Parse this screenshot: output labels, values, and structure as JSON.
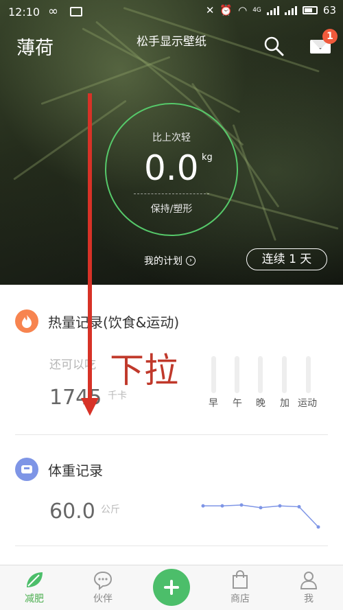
{
  "status_bar": {
    "time": "12:10",
    "signal_label": "4G",
    "battery": "63"
  },
  "header": {
    "app_name": "薄荷",
    "wallpaper_hint": "松手显示壁纸",
    "unread_count": "1"
  },
  "weight_card": {
    "compare_label": "比上次轻",
    "value": "0.0",
    "unit": "kg",
    "goal": "保持/塑形"
  },
  "plan": {
    "label": "我的计划"
  },
  "streak": {
    "label": "连续 1 天"
  },
  "calorie_section": {
    "title": "热量记录(饮食&运动)",
    "remaining_label": "还可以吃",
    "remaining_value": "1745",
    "unit": "千卡",
    "meals": [
      "早",
      "午",
      "晚",
      "加",
      "运动"
    ]
  },
  "weight_section": {
    "title": "体重记录",
    "value": "60.0",
    "unit": "公斤",
    "trend_points": [
      60.0,
      60.0,
      60.05,
      59.9,
      60.0,
      59.95,
      58.8
    ]
  },
  "overlay": {
    "pull_hint": "下拉"
  },
  "tabs": [
    {
      "label": "减肥",
      "active": true
    },
    {
      "label": "伙伴",
      "active": false
    },
    {
      "label": "商店",
      "active": false
    },
    {
      "label": "我",
      "active": false
    }
  ],
  "colors": {
    "accent": "#4cbe6a",
    "ring": "#56c96a",
    "calorie_icon": "#f7844f",
    "weight_icon": "#7e95e6",
    "overlay": "#d73227",
    "badge": "#f05a3c"
  }
}
